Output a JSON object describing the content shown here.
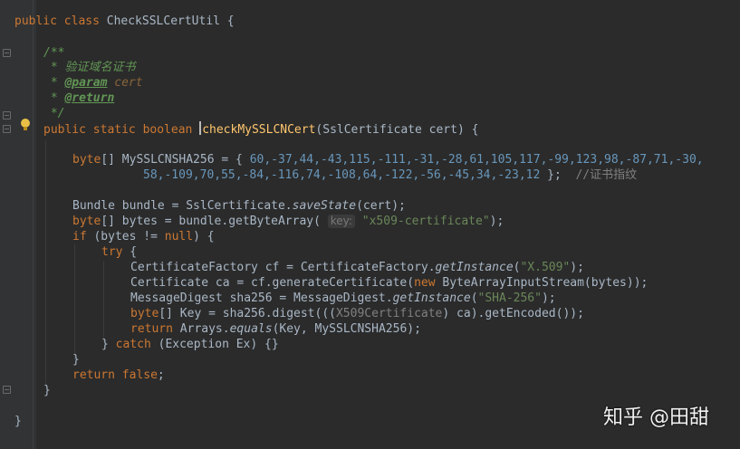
{
  "editor": {
    "colors": {
      "background": "#2b2b2b",
      "keyword": "#cc7832",
      "string": "#6a8759",
      "number": "#6897bb",
      "method_decl": "#ffc66d",
      "plain": "#a9b7c6",
      "doc_comment": "#629755",
      "comment": "#808080"
    },
    "lines": {
      "l1": {
        "kw": "public class ",
        "rest": "CheckSSLCertUtil {"
      },
      "l2": {
        "doc": "/**"
      },
      "l3": {
        "doc": " * 验证域名证书"
      },
      "l4": {
        "doc": " * ",
        "tag": "@param",
        "sp": " ",
        "param": "cert"
      },
      "l5": {
        "doc": " * ",
        "tag": "@return"
      },
      "l6": {
        "doc": " */"
      },
      "l7": {
        "kw": "public static boolean ",
        "method": "checkMySSLCNCert",
        "rest": "(SslCertificate cert) {"
      },
      "l8": {
        "kw": "byte",
        "rest1": "[] MySSLCNSHA256 = { ",
        "nums": "60,-37,44,-43,115,-111,-31,-28,61,105,117,-99,123,98,-87,71,-30,"
      },
      "l9": {
        "nums": "58,-109,70,55,-84,-116,74,-108,64,-122,-56,-45,34,-23,12",
        "rest": " };  ",
        "comment": "//证书指纹"
      },
      "l10": {
        "a": "Bundle bundle = SslCertificate.",
        "it": "saveState",
        "b": "(cert);"
      },
      "l11": {
        "kw": "byte",
        "a": "[] bytes = bundle.getByteArray( ",
        "hint": "key:",
        "str": "\"x509-certificate\"",
        "b": ");"
      },
      "l12": {
        "kw1": "if",
        "a": " (bytes != ",
        "kw2": "null",
        "b": ") {"
      },
      "l13": {
        "kw": "try",
        "b": " {"
      },
      "l14": {
        "a": "CertificateFactory cf = CertificateFactory.",
        "it": "getInstance",
        "b": "(",
        "str": "\"X.509\"",
        "c": ");"
      },
      "l15": {
        "a": "Certificate ca = cf.generateCertificate(",
        "kw": "new",
        "b": " ByteArrayInputStream(bytes));"
      },
      "l16": {
        "a": "MessageDigest sha256 = MessageDigest.",
        "it": "getInstance",
        "b": "(",
        "str": "\"SHA-256\"",
        "c": ");"
      },
      "l17": {
        "kw": "byte",
        "a": "[] Key = sha256.digest(((",
        "gray": "X509Certificate",
        "b": ") ca).getEncoded());"
      },
      "l18": {
        "kw": "return",
        "a": " Arrays.",
        "it": "equals",
        "b": "(Key, MySSLCNSHA256);"
      },
      "l19": {
        "a": "} ",
        "kw": "catch",
        "b": " (Exception Ex) {}"
      },
      "l20": {
        "a": "}"
      },
      "l21": {
        "kw": "return false",
        "b": ";"
      },
      "l22": {
        "a": "}"
      },
      "l23": {
        "a": "}"
      }
    }
  },
  "watermark": {
    "text": "知乎 @田甜"
  }
}
